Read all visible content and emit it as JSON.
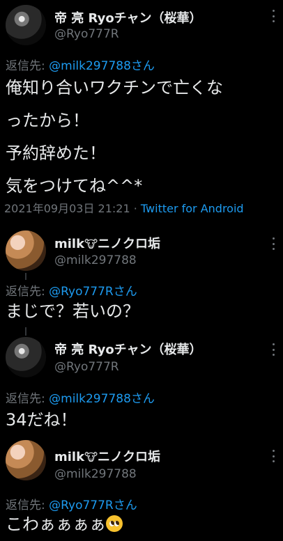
{
  "tweets": [
    {
      "name": "帝 亮 Ryoチャン（桜華）",
      "handle": "@Ryo777R",
      "reply_prefix": "返信先: ",
      "reply_to": "@milk297788さん",
      "lines": [
        "俺知り合いワクチンで亡くな",
        "ったから！",
        "予約辞めた！",
        "気をつけてね^^*"
      ],
      "timestamp": "2021年09月03日 21:21",
      "separator": " · ",
      "source": "Twitter for Android"
    },
    {
      "name_prefix": "milk",
      "name_icon": "cow-face-icon",
      "name_suffix": "ニノクロ垢",
      "handle": "@milk297788",
      "reply_prefix": "返信先: ",
      "reply_to": "@Ryo777Rさん",
      "lines": [
        "まじで？若いの？"
      ]
    },
    {
      "name": "帝 亮 Ryoチャン（桜華）",
      "handle": "@Ryo777R",
      "reply_prefix": "返信先: ",
      "reply_to": "@milk297788さん",
      "lines": [
        "34だね！"
      ]
    },
    {
      "name_prefix": "milk",
      "name_icon": "cow-face-icon",
      "name_suffix": "ニノクロ垢",
      "handle": "@milk297788",
      "reply_prefix": "返信先: ",
      "reply_to": "@Ryo777Rさん",
      "lines": [
        "こわぁぁぁぁ"
      ],
      "trailing_emoji": "pleading-face-icon"
    }
  ],
  "colors": {
    "background": "#000000",
    "text": "#e7e9ea",
    "muted": "#71767b",
    "link": "#1d9bf0"
  }
}
